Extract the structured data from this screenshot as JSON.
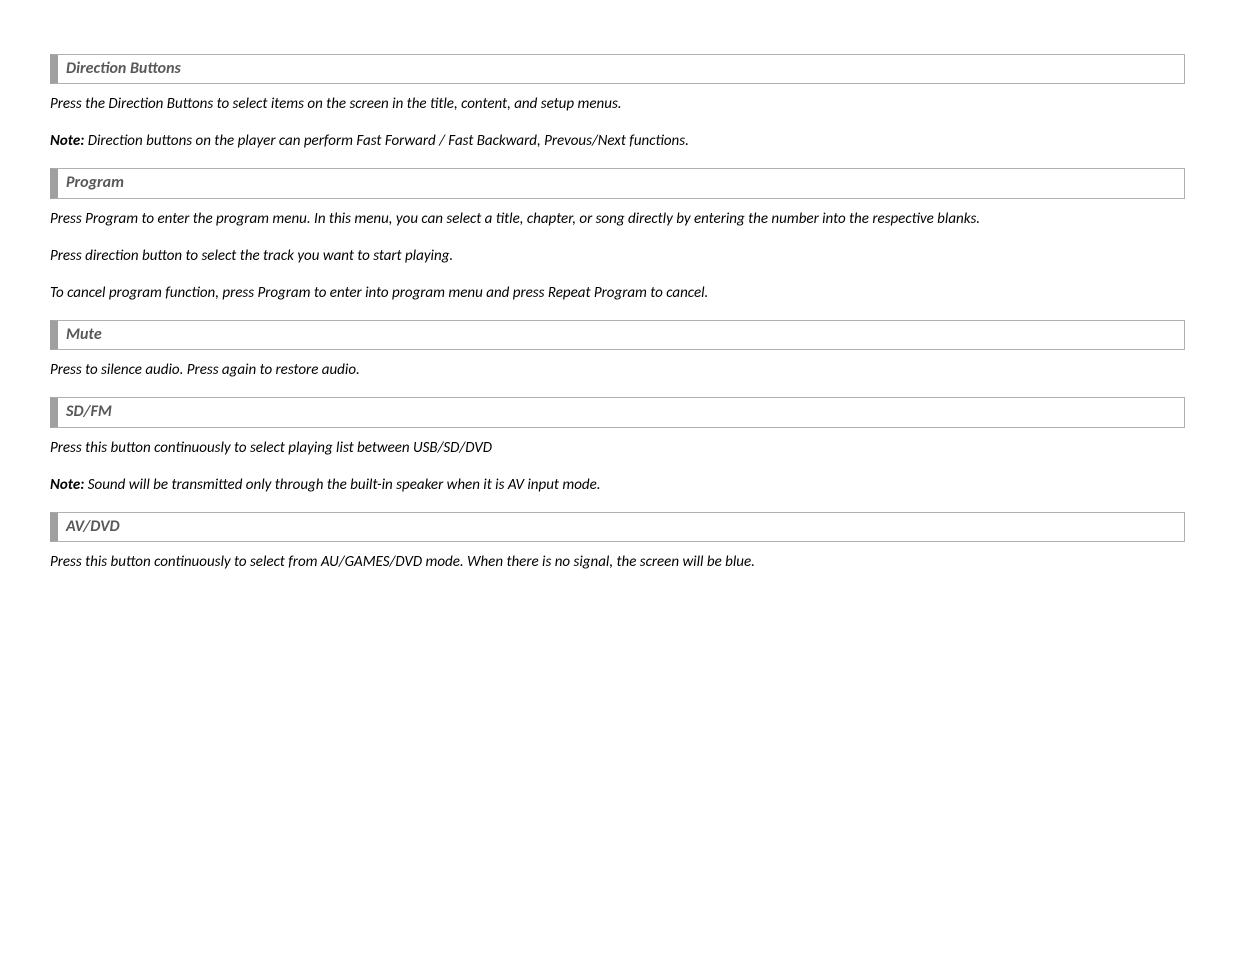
{
  "sections": [
    {
      "heading": "Direction Buttons",
      "paragraphs": [
        {
          "text": "Press the Direction Buttons to select items on the screen in the title, content, and setup menus."
        },
        {
          "note": "Note:",
          "text": " Direction buttons on the player can perform Fast Forward / Fast Backward, Prevous/Next functions."
        }
      ]
    },
    {
      "heading": "Program",
      "paragraphs": [
        {
          "text": "Press Program to enter the program menu. In this menu, you can select a title, chapter, or song directly by entering the number into the respective blanks."
        },
        {
          "text": "Press direction button to select the track you want to start playing."
        },
        {
          "text": "To cancel program function, press Program to enter into program menu and press Repeat Program to cancel."
        }
      ]
    },
    {
      "heading": "Mute",
      "paragraphs": [
        {
          "text": "Press to silence audio. Press again to restore audio."
        }
      ]
    },
    {
      "heading": "SD/FM",
      "paragraphs": [
        {
          "text": "Press this button continuously to select playing list between USB/SD/DVD"
        },
        {
          "note": "Note:",
          "text": " Sound will be transmitted only through the built-in speaker when it is AV input mode."
        }
      ]
    },
    {
      "heading": "AV/DVD",
      "paragraphs": [
        {
          "text": "Press this button continuously to select from AU/GAMES/DVD mode. When there is no signal, the screen will be blue."
        }
      ]
    }
  ]
}
